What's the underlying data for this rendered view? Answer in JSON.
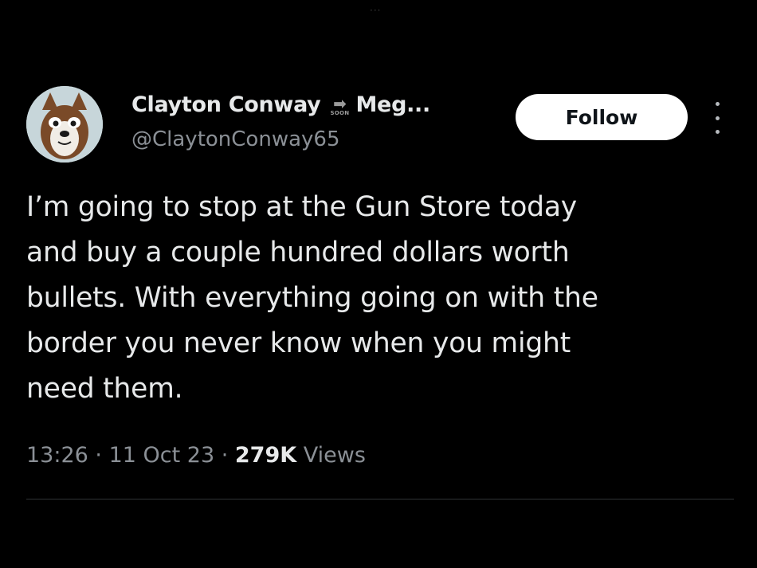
{
  "header": {
    "top_handle": "···"
  },
  "author": {
    "display_name": "Clayton Conway",
    "badge_text": "SOON",
    "name_suffix": "Meg...",
    "handle": "@ClaytonConway65",
    "avatar_icon": "cartoon-dog-avatar"
  },
  "actions": {
    "follow_label": "Follow",
    "more_icon": "vertical-ellipsis-icon"
  },
  "tweet": {
    "text": "I’m going to stop at the Gun Store today\nand buy a couple hundred dollars worth\nbullets. With everything going on with the\nborder you never know when you might\nneed them."
  },
  "meta": {
    "time": "13:26",
    "separator": " · ",
    "date": "11 Oct 23",
    "views_count": "279K",
    "views_label": " Views"
  },
  "colors": {
    "background": "#000000",
    "primary_text": "#e7e9ea",
    "secondary_text": "#8b9096",
    "follow_button_bg": "#ffffff",
    "divider": "#2f3336"
  }
}
